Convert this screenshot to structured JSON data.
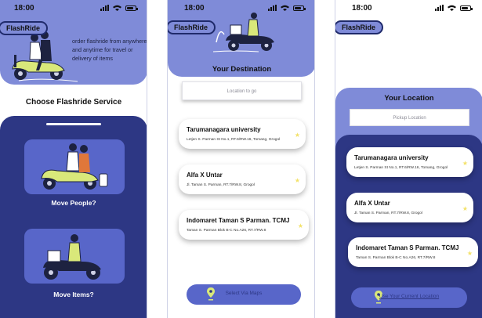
{
  "status": {
    "time": "18:00"
  },
  "brand": {
    "logo_text": "FlashRide"
  },
  "home": {
    "tagline": "order flashride from anywhere and anytime for travel or delivery of items",
    "section_title": "Choose Flashride Service",
    "services": [
      {
        "label": "Move People?"
      },
      {
        "label": "Move Items?"
      }
    ]
  },
  "destination": {
    "title": "Your Destination",
    "search_placeholder": "Location to go",
    "locations": [
      {
        "name": "Tarumanagara university",
        "address": "Letjen S. Parman St No.1, RT.6/RW.16, Tomang, Grogol"
      },
      {
        "name": "Alfa X Untar",
        "address": "Jl. Taman S. Parman, RT.7/RW.8, Grogol"
      },
      {
        "name": "Indomaret Taman S Parman. TCMJ",
        "address": "Taman S. Parman Blok B-C No.A26, RT.7/RW.8"
      }
    ],
    "map_button": "Select Via Maps"
  },
  "pickup": {
    "title": "Your Location",
    "search_placeholder": "Pickup Location",
    "locations": [
      {
        "name": "Tarumanagara university",
        "address": "Letjen S. Parman St No.1, RT.6/RW.16, Tomang, Grogol"
      },
      {
        "name": "Alfa X Untar",
        "address": "Jl. Taman S. Parman, RT.7/RW.8, Grogol"
      },
      {
        "name": "Indomaret Taman S Parman. TCMJ",
        "address": "Taman S. Parman Blok B-C No.A26, RT.7/RW.8"
      }
    ],
    "current_button": "Use Your Current Location"
  },
  "colors": {
    "primary_light": "#7f8bd8",
    "primary_dark": "#2d3784",
    "accent": "#5866c9",
    "scooter": "#d9e87a"
  },
  "icons": [
    "signal-icon",
    "wifi-icon",
    "battery-icon",
    "star-icon",
    "location-pin-icon"
  ]
}
